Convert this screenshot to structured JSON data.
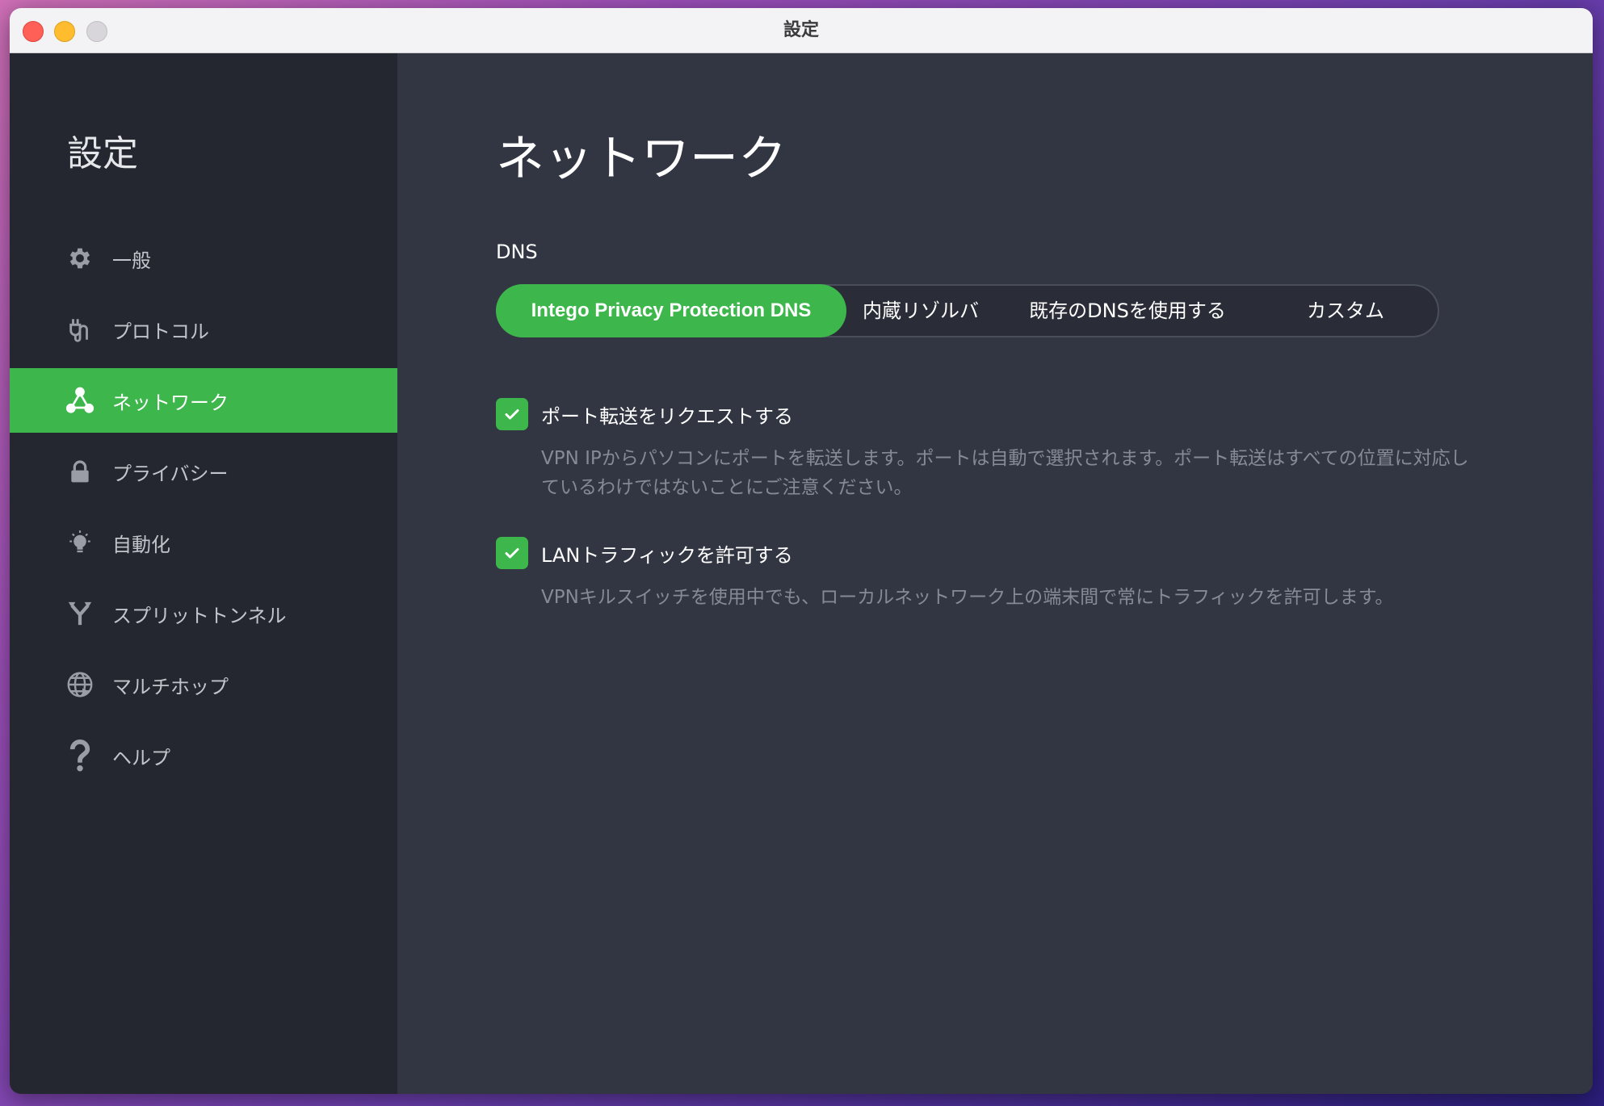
{
  "window": {
    "title": "設定"
  },
  "sidebar": {
    "title": "設定",
    "items": [
      {
        "label": "一般",
        "icon": "gear-icon"
      },
      {
        "label": "プロトコル",
        "icon": "plug-icon"
      },
      {
        "label": "ネットワーク",
        "icon": "network-icon",
        "active": true
      },
      {
        "label": "プライバシー",
        "icon": "lock-icon"
      },
      {
        "label": "自動化",
        "icon": "lightbulb-icon"
      },
      {
        "label": "スプリットトンネル",
        "icon": "split-icon"
      },
      {
        "label": "マルチホップ",
        "icon": "globe-icon"
      },
      {
        "label": "ヘルプ",
        "icon": "question-icon"
      }
    ]
  },
  "main": {
    "title": "ネットワーク",
    "dns": {
      "label": "DNS",
      "options": [
        {
          "label": "Intego Privacy Protection DNS",
          "selected": true
        },
        {
          "label": "内蔵リゾルバ",
          "selected": false
        },
        {
          "label": "既存のDNSを使用する",
          "selected": false
        },
        {
          "label": "カスタム",
          "selected": false
        }
      ]
    },
    "options": [
      {
        "label": "ポート転送をリクエストする",
        "checked": true,
        "description": "VPN IPからパソコンにポートを転送します。ポートは自動で選択されます。ポート転送はすべての位置に対応しているわけではないことにご注意ください。"
      },
      {
        "label": "LANトラフィックを許可する",
        "checked": true,
        "description": "VPNキルスイッチを使用中でも、ローカルネットワーク上の端末間で常にトラフィックを許可します。"
      }
    ]
  },
  "colors": {
    "accent": "#3db74c",
    "sidebar_bg": "#252730",
    "main_bg": "#323642",
    "muted_text": "#868a96"
  }
}
